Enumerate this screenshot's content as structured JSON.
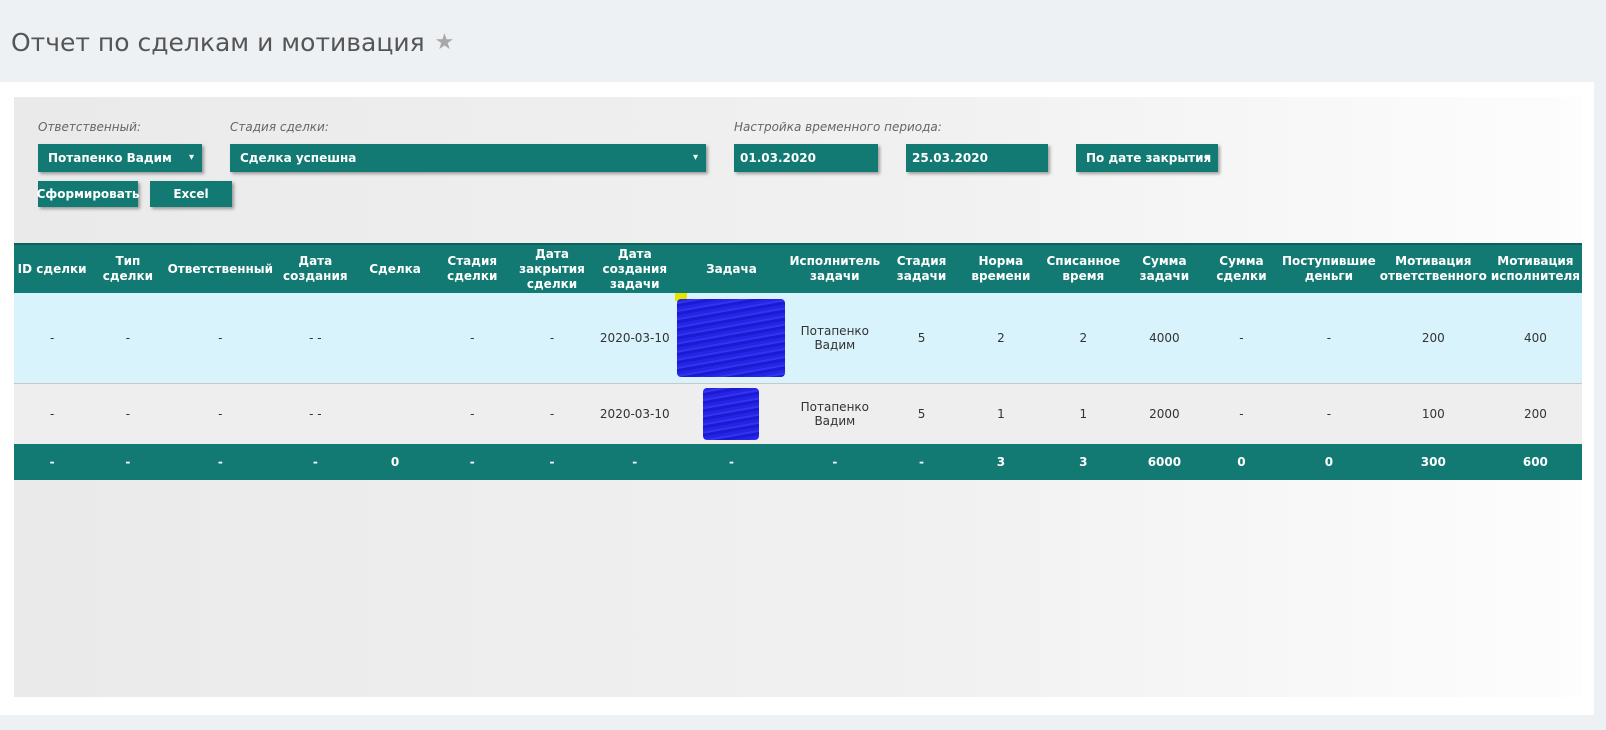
{
  "page": {
    "title": "Отчет по сделкам и мотивация",
    "star_icon": "star-icon"
  },
  "filters": {
    "responsible": {
      "label": "Ответственный:",
      "value": "Потапенко Вадим"
    },
    "deal_stage": {
      "label": "Стадия сделки:",
      "value": "Сделка успешна"
    },
    "period": {
      "label": "Настройка временного периода:",
      "date_from": "01.03.2020",
      "date_to": "25.03.2020",
      "mode": "По дате закрытия"
    },
    "caret": "▾"
  },
  "buttons": {
    "generate": "Сформировать",
    "excel": "Excel"
  },
  "table": {
    "headers": [
      "ID сделки",
      "Тип сделки",
      "Ответственный",
      "Дата создания",
      "Сделка",
      "Стадия сделки",
      "Дата закрытия сделки",
      "Дата создания задачи",
      "Задача",
      "Исполнитель задачи",
      "Стадия задачи",
      "Норма времени",
      "Списанное время",
      "Сумма задачи",
      "Сумма сделки",
      "Поступившие деньги",
      "Мотивация ответственного",
      "Мотивация исполнителя"
    ],
    "rows": [
      [
        "-",
        "-",
        "-",
        "-  -",
        "",
        "-",
        "-",
        "2020-03-10",
        "",
        "Потапенко Вадим",
        "5",
        "2",
        "2",
        "4000",
        "-",
        "-",
        "200",
        "400"
      ],
      [
        "-",
        "-",
        "-",
        "-  -",
        "",
        "-",
        "-",
        "2020-03-10",
        "",
        "Потапенко Вадим",
        "5",
        "1",
        "1",
        "2000",
        "-",
        "-",
        "100",
        "200"
      ]
    ],
    "totals": [
      "-",
      "-",
      "-",
      "-",
      "0",
      "-",
      "-",
      "-",
      "-",
      "-",
      "-",
      "3",
      "3",
      "6000",
      "0",
      "0",
      "300",
      "600"
    ]
  },
  "colors": {
    "accent": "#127a73",
    "row_highlight": "#d8f3fb",
    "redaction": "#1a1ae6"
  }
}
